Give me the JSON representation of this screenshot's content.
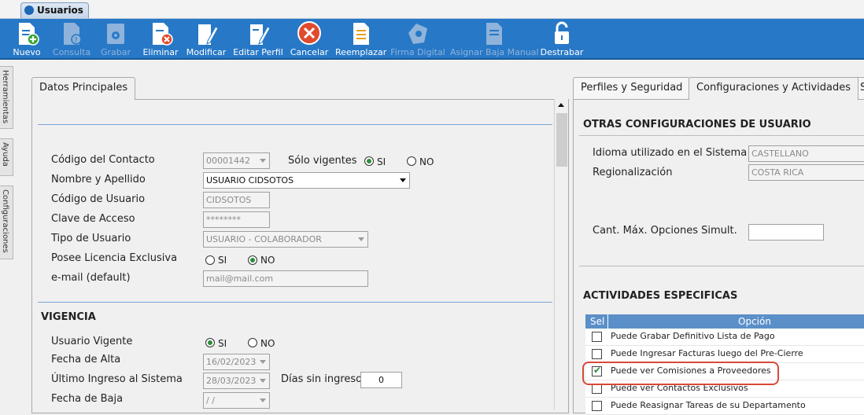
{
  "window": {
    "tab_title": "Usuarios"
  },
  "toolbar": {
    "buttons": [
      {
        "label": "Nuevo",
        "icon": "new-document-icon",
        "enabled": true
      },
      {
        "label": "Consulta",
        "icon": "query-icon",
        "enabled": false
      },
      {
        "label": "Grabar",
        "icon": "save-icon",
        "enabled": false
      },
      {
        "label": "Eliminar",
        "icon": "delete-icon",
        "enabled": true
      },
      {
        "label": "Modificar",
        "icon": "edit-icon",
        "enabled": true
      },
      {
        "label": "Editar Perfil",
        "icon": "edit-profile-icon",
        "enabled": true
      },
      {
        "label": "Cancelar",
        "icon": "cancel-icon",
        "enabled": true
      },
      {
        "label": "Reemplazar",
        "icon": "replace-icon",
        "enabled": true
      },
      {
        "label": "Firma Digital",
        "icon": "digital-signature-icon",
        "enabled": false
      },
      {
        "label": "Asignar Baja Manual",
        "icon": "assign-manual-icon",
        "enabled": false
      },
      {
        "label": "Destrabar",
        "icon": "unlock-icon",
        "enabled": true
      }
    ]
  },
  "side_tabs": [
    "Herramientas",
    "Ayuda",
    "Configuraciones"
  ],
  "left_panel": {
    "tab": "Datos Principales",
    "codigo_contacto": {
      "label": "Código del Contacto",
      "value": "00001442"
    },
    "solo_vigentes": {
      "label": "Sólo vigentes",
      "si": "SI",
      "no": "NO",
      "selected": "SI"
    },
    "nombre_apellido": {
      "label": "Nombre y Apellido",
      "value": "USUARIO CIDSOTOS"
    },
    "codigo_usuario": {
      "label": "Código de Usuario",
      "value": "CIDSOTOS"
    },
    "clave_acceso": {
      "label": "Clave de Acceso",
      "value": "********"
    },
    "tipo_usuario": {
      "label": "Tipo de Usuario",
      "value": "USUARIO - COLABORADOR"
    },
    "licencia_exclusiva": {
      "label": "Posee Licencia Exclusiva",
      "si": "SI",
      "no": "NO",
      "selected": "NO"
    },
    "email": {
      "label": "e-mail (default)",
      "placeholder": "mail@mail.com"
    },
    "vigencia_title": "VIGENCIA",
    "usuario_vigente": {
      "label": "Usuario Vigente",
      "si": "SI",
      "no": "NO",
      "selected": "SI"
    },
    "fecha_alta": {
      "label": "Fecha de Alta",
      "value": "16/02/2023"
    },
    "ultimo_ingreso": {
      "label": "Último Ingreso al Sistema",
      "value": "28/03/2023"
    },
    "dias_sin_ingreso": {
      "label": "Días sin ingreso",
      "value": "0"
    },
    "fecha_baja": {
      "label": "Fecha de Baja",
      "value": " / / "
    }
  },
  "right_panel": {
    "tabs": [
      "Perfiles y Seguridad",
      "Configuraciones y Actividades",
      "S"
    ],
    "selected_tab": "Configuraciones y Actividades",
    "otras_title": "OTRAS CONFIGURACIONES DE USUARIO",
    "idioma": {
      "label": "Idioma utilizado en el Sistema",
      "value": "CASTELLANO"
    },
    "regionalizacion": {
      "label": "Regionalización",
      "value": "COSTA RICA"
    },
    "cant_max": {
      "label": "Cant. Máx. Opciones Simult.",
      "value": ""
    },
    "actividades_title": "ACTIVIDADES ESPECIFICAS",
    "table_headers": {
      "sel": "Sel",
      "opcion": "Opción"
    },
    "actividades": [
      {
        "label": "Puede Grabar Definitivo Lista de Pago",
        "checked": false
      },
      {
        "label": "Puede Ingresar Facturas luego del Pre-Cierre",
        "checked": false
      },
      {
        "label": "Puede ver Comisiones a Proveedores",
        "checked": true
      },
      {
        "label": "Puede ver Contactos Exclusivos",
        "checked": false
      },
      {
        "label": "Puede Reasignar Tareas de su Departamento",
        "checked": false
      }
    ]
  }
}
